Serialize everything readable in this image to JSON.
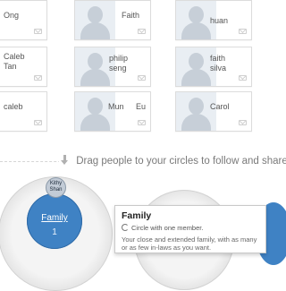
{
  "people": {
    "row1": {
      "left": "Ong",
      "middle": "Faith",
      "right": "huan"
    },
    "row2": {
      "left_line1": "Caleb",
      "left_line2": "Tan",
      "middle_line1": "philip",
      "middle_line2": "seng",
      "right_line1": "faith",
      "right_line2": "silva"
    },
    "row3": {
      "left": "caleb",
      "middle_first": "Mun",
      "middle_last": "Eu",
      "right": "Carol"
    }
  },
  "instruction": {
    "text": "Drag people to your circles to follow and share"
  },
  "circle": {
    "name": "Family",
    "count": "1",
    "member_label": "Kithy Shan"
  },
  "tooltip": {
    "title": "Family",
    "subtitle": "Circle with one member.",
    "description": "Your close and extended family, with as many or as few in-laws as you want."
  },
  "colors": {
    "circle_blue": "#3f82c4",
    "card_border": "#dcdcdc"
  }
}
